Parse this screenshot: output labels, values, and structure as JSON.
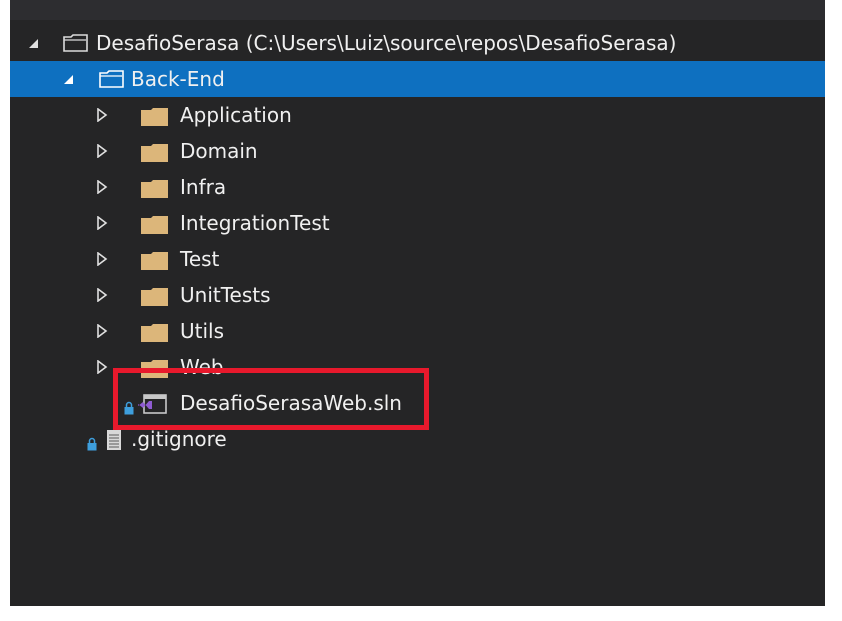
{
  "solution_explorer": {
    "root": {
      "label": "DesafioSerasa (C:\\Users\\Luiz\\source\\repos\\DesafioSerasa)",
      "expanded": true,
      "icon": "solution-folder-icon"
    },
    "selected_folder": {
      "label": "Back-End",
      "expanded": true,
      "icon": "solution-folder-icon"
    },
    "folders": [
      {
        "label": "Application",
        "icon": "folder-icon"
      },
      {
        "label": "Domain",
        "icon": "folder-icon"
      },
      {
        "label": "Infra",
        "icon": "folder-icon"
      },
      {
        "label": "IntegrationTest",
        "icon": "folder-icon"
      },
      {
        "label": "Test",
        "icon": "folder-icon"
      },
      {
        "label": "UnitTests",
        "icon": "folder-icon"
      },
      {
        "label": "Utils",
        "icon": "folder-icon"
      },
      {
        "label": "Web",
        "icon": "folder-icon"
      }
    ],
    "solution_file": {
      "label": "DesafioSerasaWeb.sln",
      "icon": "visual-studio-solution-icon"
    },
    "gitignore_file": {
      "label": ".gitignore",
      "icon": "text-file-icon"
    }
  },
  "colors": {
    "background": "#252526",
    "selection": "#0e70c0",
    "folder": "#dcb67a",
    "highlight_box": "#e8192c",
    "lock": "#3e9fdd"
  }
}
